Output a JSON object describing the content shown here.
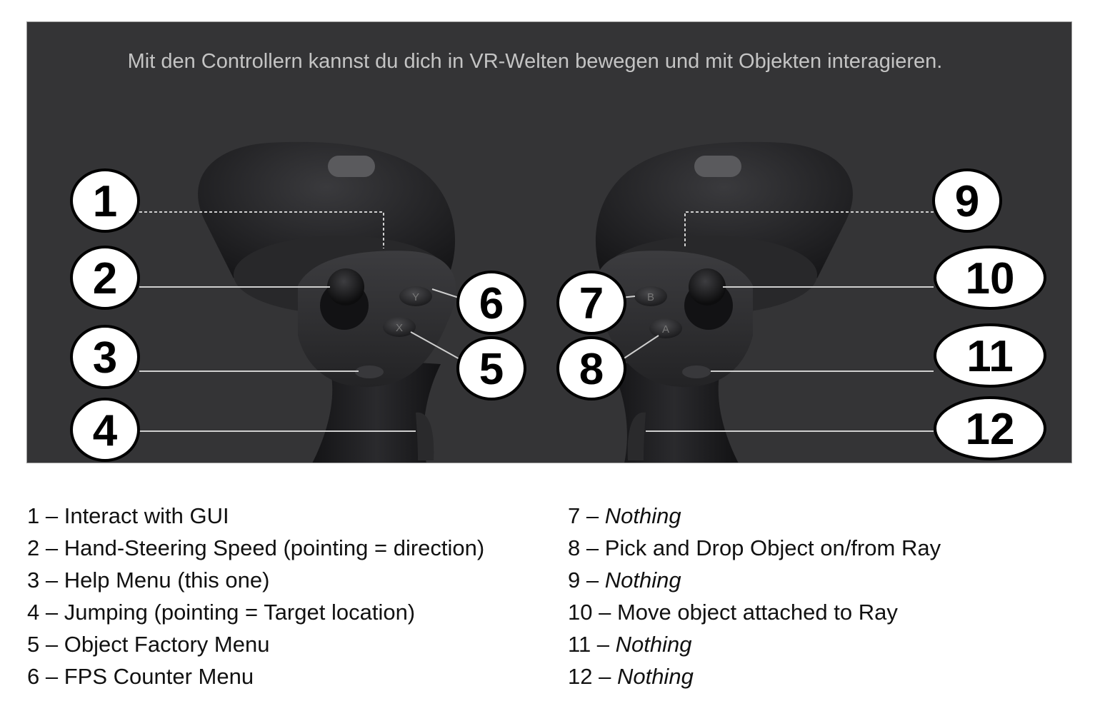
{
  "intro_text": "Mit den Controllern kannst du dich in VR-Welten bewegen und mit Objekten interagieren.",
  "colors": {
    "panel_background": "#343436",
    "intro_text": "#c4c4c4",
    "callout_fill": "#ffffff",
    "callout_stroke": "#000000",
    "leader_line": "#cfcfcf",
    "controller_body": "#1f1f21"
  },
  "controllers": {
    "left_buttons": {
      "upper": "Y",
      "lower": "X"
    },
    "right_buttons": {
      "upper": "B",
      "lower": "A"
    }
  },
  "callouts": {
    "c1": "1",
    "c2": "2",
    "c3": "3",
    "c4": "4",
    "c5": "5",
    "c6": "6",
    "c7": "7",
    "c8": "8",
    "c9": "9",
    "c10": "10",
    "c11": "11",
    "c12": "12"
  },
  "legend": {
    "left": [
      {
        "number": "1",
        "desc": "Interact with GUI",
        "italic": false
      },
      {
        "number": "2",
        "desc": "Hand-Steering Speed (pointing = direction)",
        "italic": false
      },
      {
        "number": "3",
        "desc": "Help Menu (this one)",
        "italic": false
      },
      {
        "number": "4",
        "desc": "Jumping  (pointing = Target location)",
        "italic": false
      },
      {
        "number": "5",
        "desc": "Object Factory Menu",
        "italic": false
      },
      {
        "number": "6",
        "desc": "FPS Counter Menu",
        "italic": false
      }
    ],
    "right": [
      {
        "number": "7",
        "desc": "Nothing",
        "italic": true
      },
      {
        "number": "8",
        "desc": " Pick and Drop Object on/from Ray",
        "italic": false
      },
      {
        "number": "9",
        "desc": "Nothing",
        "italic": true
      },
      {
        "number": "10",
        "desc": "Move object attached to Ray",
        "italic": false
      },
      {
        "number": "11",
        "desc": "Nothing",
        "italic": true
      },
      {
        "number": "12",
        "desc": "Nothing",
        "italic": true
      }
    ]
  }
}
